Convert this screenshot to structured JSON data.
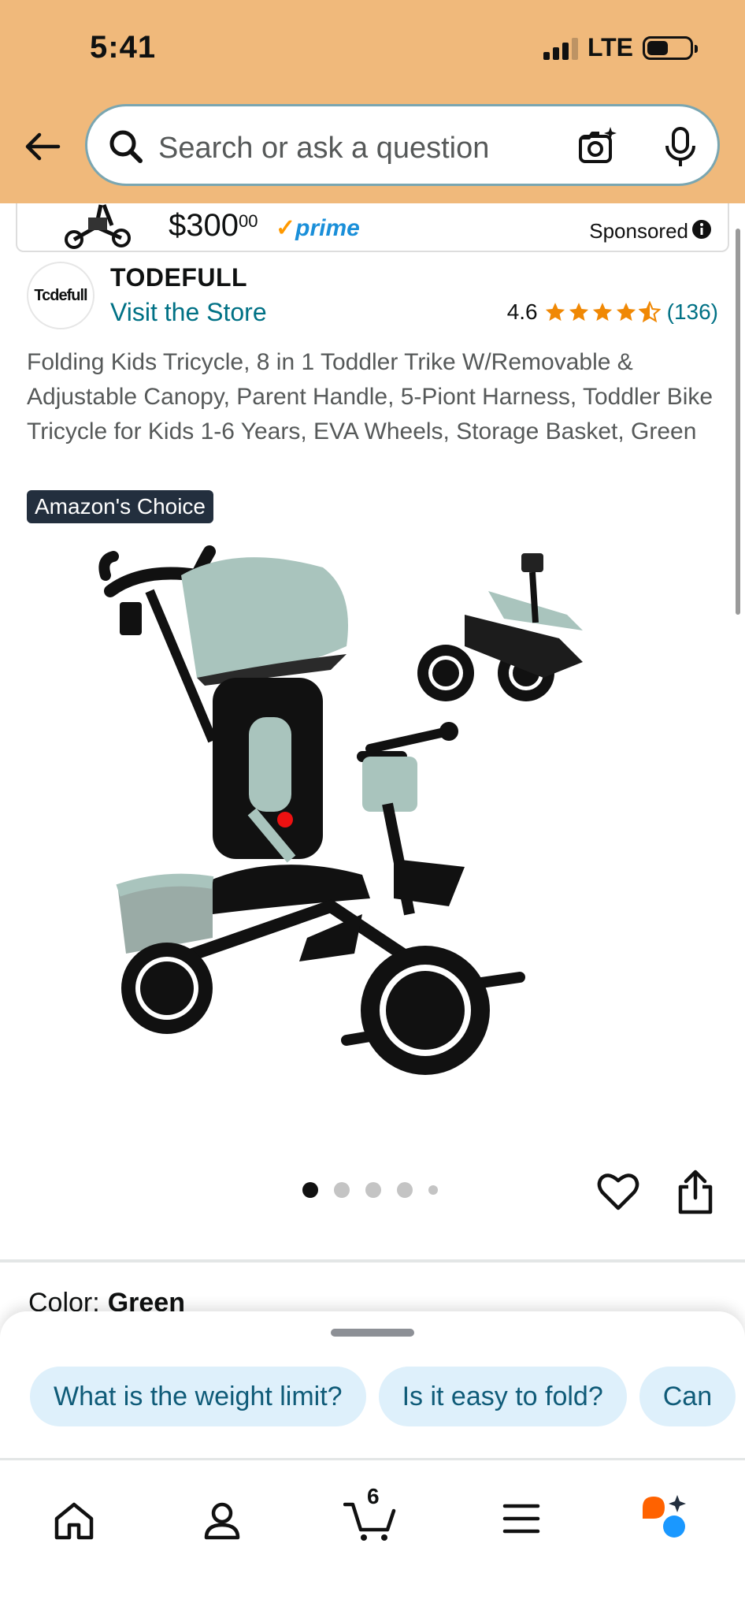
{
  "status_bar": {
    "time": "5:41",
    "network": "LTE"
  },
  "search": {
    "placeholder": "Search or ask a question"
  },
  "sponsored": {
    "price_whole": "$300",
    "price_fraction": "00",
    "prime": "prime",
    "label": "Sponsored"
  },
  "brand": {
    "logo_text": "Tcdefull",
    "name": "TODEFULL",
    "visit_store": "Visit the Store"
  },
  "rating": {
    "value": "4.6",
    "stars": 4.5,
    "count": "(136)"
  },
  "product": {
    "title": "Folding Kids Tricycle, 8 in 1 Toddler Trike W/Removable & Adjustable Canopy, Parent Handle, 5-Piont Harness, Toddler Bike Tricycle for Kids 1-6 Years, EVA Wheels, Storage Basket, Green",
    "badge": "Amazon's Choice",
    "image_count": 5,
    "active_image": 0
  },
  "color": {
    "label": "Color:",
    "value": "Green"
  },
  "questions": [
    "What is the weight limit?",
    "Is it easy to fold?",
    "Can"
  ],
  "nav": {
    "cart_count": "6",
    "items": [
      "home-icon",
      "account-icon",
      "cart-icon",
      "menu-icon",
      "rufus-icon"
    ]
  },
  "colors": {
    "header": "#f0b97b",
    "link": "#007185",
    "star": "#f08804",
    "chip": "#def0fb",
    "badge": "#232f3e"
  }
}
